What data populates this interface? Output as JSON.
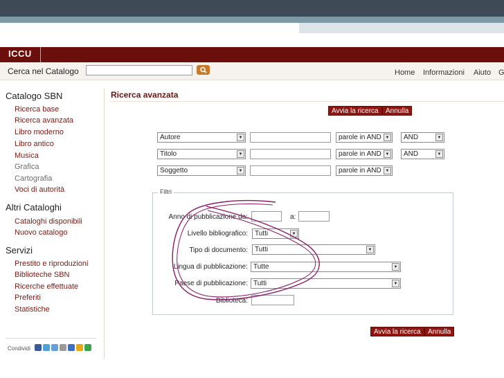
{
  "header": {
    "logo": "ICCU",
    "search_label": "Cerca nel Catalogo",
    "search_value": "",
    "nav": [
      "Home",
      "Informazioni",
      "Aiuto",
      "G"
    ]
  },
  "sidebar": {
    "sections": [
      {
        "title": "Catalogo SBN",
        "items": [
          "Ricerca base",
          "Ricerca avanzata",
          "Libro moderno",
          "Libro antico",
          "Musica",
          "Grafica",
          "Cartografia",
          "Voci di autorità"
        ],
        "disabled": [
          false,
          false,
          false,
          false,
          false,
          true,
          true,
          false
        ]
      },
      {
        "title": "Altri Cataloghi",
        "items": [
          "Cataloghi disponibili",
          "Nuovo catalogo"
        ],
        "disabled": [
          false,
          false
        ]
      },
      {
        "title": "Servizi",
        "items": [
          "Prestito e riproduzioni",
          "Biblioteche SBN",
          "Ricerche effettuate",
          "Preferiti",
          "Statistiche"
        ],
        "disabled": [
          false,
          false,
          false,
          false,
          false
        ]
      }
    ],
    "share_label": "Condividi"
  },
  "main": {
    "title": "Ricerca avanzata",
    "search_button": "Avvia la ricerca",
    "cancel_button": "Annulla",
    "rows": [
      {
        "field": "Autore",
        "value": "",
        "mode": "parole in AND",
        "op": "AND"
      },
      {
        "field": "Titolo",
        "value": "",
        "mode": "parole in AND",
        "op": "AND"
      },
      {
        "field": "Soggetto",
        "value": "",
        "mode": "parole in AND",
        "op": ""
      }
    ],
    "filters": {
      "legend": "Filtri",
      "anno_label": "Anno di pubblicazione da:",
      "anno_a_label": "a:",
      "anno_da": "",
      "anno_a": "",
      "livello_label": "Livello bibliografico:",
      "livello_value": "Tutti",
      "tipo_label": "Tipo di documento:",
      "tipo_value": "Tutti",
      "lingua_label": "Lingua di pubblicazione:",
      "lingua_value": "Tutte",
      "paese_label": "Paese di pubblicazione:",
      "paese_value": "Tutti",
      "biblioteca_label": "Biblioteca:",
      "biblioteca_value": ""
    }
  },
  "colors": {
    "brand": "#6b0f0c",
    "button": "#8e1510",
    "annotation": "#8a1a6a"
  }
}
